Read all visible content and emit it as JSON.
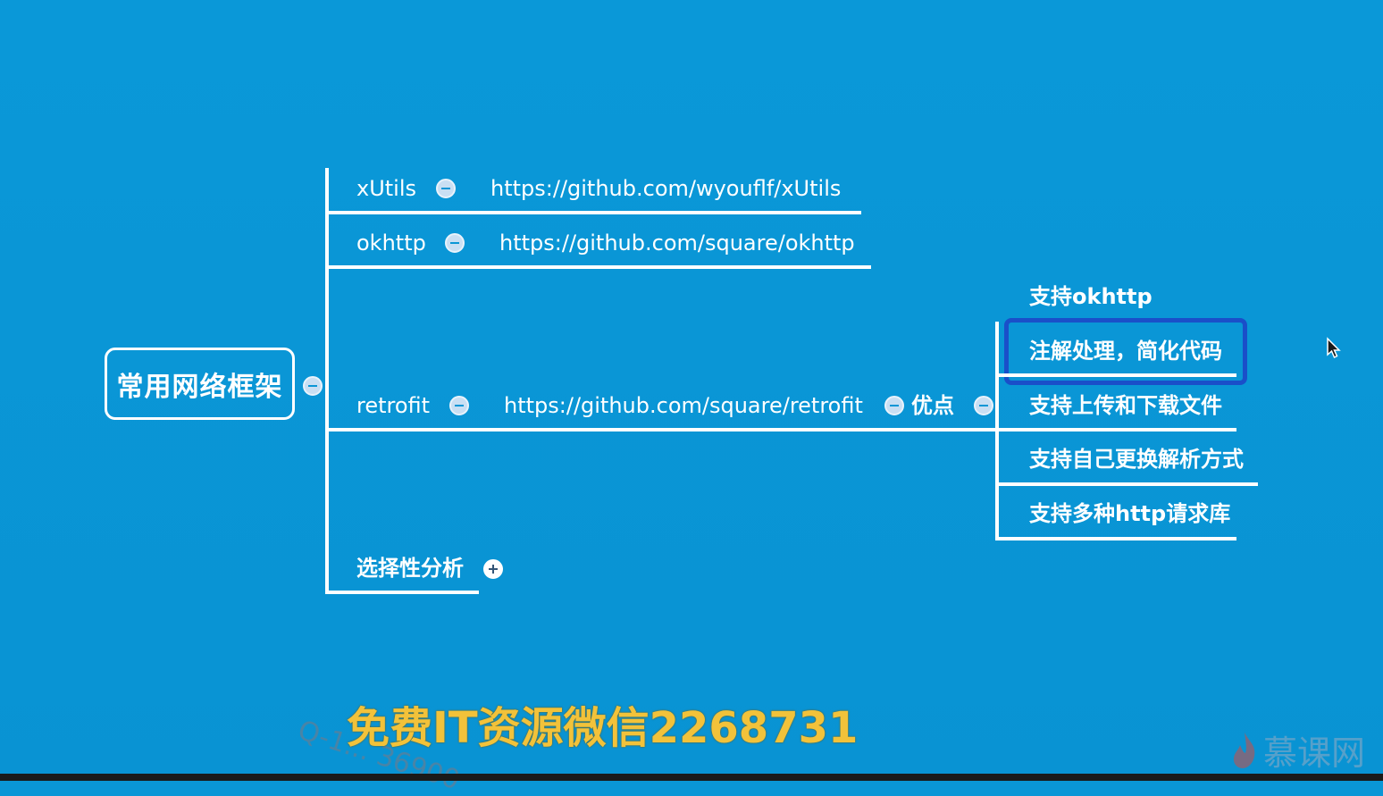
{
  "root": {
    "label": "常用网络框架"
  },
  "branches": [
    {
      "label": "xUtils",
      "url": "https://github.com/wyouflf/xUtils"
    },
    {
      "label": "okhttp",
      "url": "https://github.com/square/okhttp"
    },
    {
      "label": "retrofit",
      "url": "https://github.com/square/retrofit",
      "child": "优点"
    },
    {
      "label": "选择性分析"
    }
  ],
  "advantages": [
    "支持okhttp",
    "注解处理，简化代码",
    "支持上传和下载文件",
    "支持自己更换解析方式",
    "支持多种http请求库"
  ],
  "overlay": {
    "caption": "免费IT资源微信2268731",
    "watermark_q": "Q-1... 36900",
    "logo_text": "慕课网"
  },
  "colors": {
    "background": "#0a96d6",
    "caption": "#f2c23a",
    "selection": "#1a4fc9"
  },
  "icons": [
    "collapse-icon",
    "expand-icon",
    "cursor-icon",
    "flame-logo-icon"
  ]
}
